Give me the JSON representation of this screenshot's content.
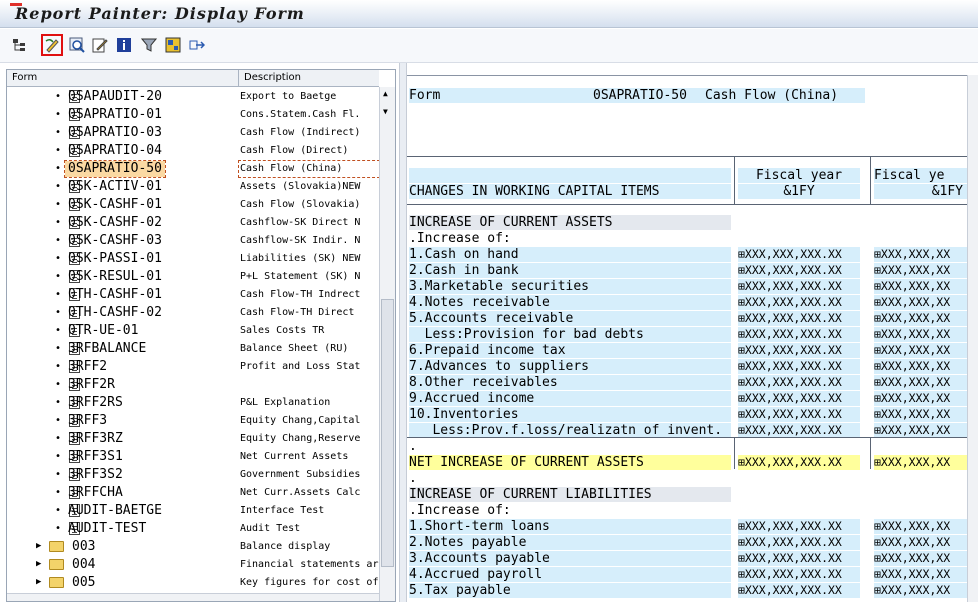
{
  "window": {
    "title": "Report Painter: Display Form"
  },
  "toolbar": {
    "icons": [
      "hierarchy-icon",
      "change-display-icon",
      "find-icon",
      "edit-icon",
      "info-icon",
      "filter-icon",
      "layout-icon",
      "export-icon"
    ]
  },
  "tree": {
    "col_form": "Form",
    "col_description": "Description",
    "items": [
      {
        "form": "0SAPAUDIT-20",
        "desc": "Export to Baetge"
      },
      {
        "form": "0SAPRATIO-01",
        "desc": "Cons.Statem.Cash Fl."
      },
      {
        "form": "0SAPRATIO-03",
        "desc": "Cash Flow (Indirect)"
      },
      {
        "form": "0SAPRATIO-04",
        "desc": "Cash Flow (Direct)"
      },
      {
        "form": "0SAPRATIO-50",
        "desc": "Cash Flow  (China)"
      },
      {
        "form": "0SK-ACTIV-01",
        "desc": "Assets (Slovakia)NEW"
      },
      {
        "form": "0SK-CASHF-01",
        "desc": "Cash Flow (Slovakia)"
      },
      {
        "form": "0SK-CASHF-02",
        "desc": "Cashflow-SK Direct N"
      },
      {
        "form": "0SK-CASHF-03",
        "desc": "Cashflow-SK Indir. N"
      },
      {
        "form": "0SK-PASSI-01",
        "desc": "Liabilities (SK) NEW"
      },
      {
        "form": "0SK-RESUL-01",
        "desc": "P+L Statement (SK) N"
      },
      {
        "form": "0TH-CASHF-01",
        "desc": "Cash Flow-TH Indrect"
      },
      {
        "form": "0TH-CASHF-02",
        "desc": "Cash Flow-TH Direct"
      },
      {
        "form": "0TR-UE-01",
        "desc": "Sales Costs TR"
      },
      {
        "form": "3RFBALANCE",
        "desc": "Balance Sheet (RU)"
      },
      {
        "form": "3RFF2",
        "desc": "Profit and Loss Stat"
      },
      {
        "form": "3RFF2R",
        "desc": ""
      },
      {
        "form": "3RFF2RS",
        "desc": "P&L Explanation"
      },
      {
        "form": "3RFF3",
        "desc": "Equity Chang,Capital"
      },
      {
        "form": "3RFF3RZ",
        "desc": "Equity Chang,Reserve"
      },
      {
        "form": "3RFF3S1",
        "desc": "Net Current Assets"
      },
      {
        "form": "3RFF3S2",
        "desc": "Government Subsidies"
      },
      {
        "form": "3RFFCHA",
        "desc": "Net Curr.Assets Calc"
      },
      {
        "form": "AUDIT-BAETGE",
        "desc": "Interface Test"
      },
      {
        "form": "AUDIT-TEST",
        "desc": "Audit Test"
      }
    ],
    "folders": [
      {
        "form": "003",
        "desc": "Balance display"
      },
      {
        "form": "004",
        "desc": "Financial statements ar"
      },
      {
        "form": "005",
        "desc": "Key figures for cost of"
      }
    ]
  },
  "report": {
    "form_label": "Form",
    "form_id": "0SAPRATIO-50",
    "form_desc": "Cash Flow  (China)",
    "col_header_main": "CHANGES IN WORKING CAPITAL ITEMS",
    "col1_line1": "Fiscal year",
    "col1_line2": "&1FY",
    "col2_line1": "Fiscal ye",
    "col2_line2": "&1FY",
    "placeholder": "XXX,XXX,XXX.XX",
    "placeholder_cut": "XXX,XXX,XX",
    "lines": [
      {
        "text": "INCREASE OF CURRENT ASSETS",
        "type": "section"
      },
      {
        "text": ".Increase of:",
        "type": "plain"
      },
      {
        "text": "1.Cash on hand",
        "type": "item"
      },
      {
        "text": "2.Cash in bank",
        "type": "item"
      },
      {
        "text": "3.Marketable securities",
        "type": "item"
      },
      {
        "text": "4.Notes receivable",
        "type": "item"
      },
      {
        "text": "5.Accounts receivable",
        "type": "item"
      },
      {
        "text": "  Less:Provision for bad debts",
        "type": "item"
      },
      {
        "text": "6.Prepaid income tax",
        "type": "item"
      },
      {
        "text": "7.Advances to suppliers",
        "type": "item"
      },
      {
        "text": "8.Other receivables",
        "type": "item"
      },
      {
        "text": "9.Accrued income",
        "type": "item"
      },
      {
        "text": "10.Inventories",
        "type": "item"
      },
      {
        "text": "   Less:Prov.f.loss/realizatn of invent.",
        "type": "item"
      },
      {
        "text": ".",
        "type": "plain"
      },
      {
        "text": "NET INCREASE OF CURRENT ASSETS",
        "type": "total"
      },
      {
        "text": ".",
        "type": "plain"
      },
      {
        "text": "INCREASE OF CURRENT LIABILITIES",
        "type": "section"
      },
      {
        "text": ".Increase of:",
        "type": "plain"
      },
      {
        "text": "1.Short-term loans",
        "type": "item"
      },
      {
        "text": "2.Notes payable",
        "type": "item"
      },
      {
        "text": "3.Accounts payable",
        "type": "item"
      },
      {
        "text": "4.Accrued payroll",
        "type": "item"
      },
      {
        "text": "5.Tax payable",
        "type": "item"
      }
    ]
  },
  "colors": {
    "highlight": "#d6eefb",
    "total": "#ffff9c",
    "selected": "#fbd9a3",
    "active_tool": "#e01010"
  }
}
